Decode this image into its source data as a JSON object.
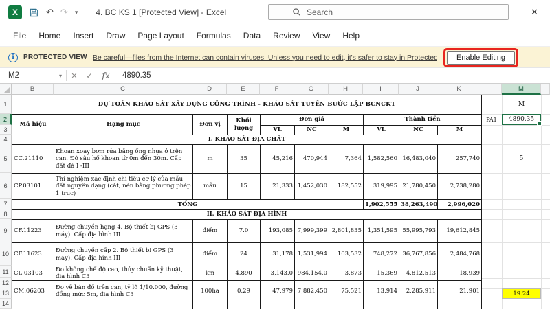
{
  "icons": {
    "excel": "X",
    "undo": "↶",
    "redo": "↷",
    "qat_caret": "▾",
    "close": "✕",
    "info": "i",
    "cancel": "✕",
    "enter": "✓",
    "namebox_caret": "▾"
  },
  "titlebar": {
    "title": "4. BC KS  1  [Protected View] -  Excel",
    "search_placeholder": "Search"
  },
  "ribbon": {
    "tabs": [
      "File",
      "Home",
      "Insert",
      "Draw",
      "Page Layout",
      "Formulas",
      "Data",
      "Review",
      "View",
      "Help"
    ]
  },
  "message_bar": {
    "label": "PROTECTED VIEW",
    "message": "Be careful—files from the Internet can contain viruses. Unless you need to edit, it's safer to stay in Protected View.",
    "button": "Enable Editing"
  },
  "formula_bar": {
    "name_box": "M2",
    "fx_label": "fx",
    "value": "4890.35"
  },
  "grid": {
    "col_headers": [
      "B",
      "C",
      "D",
      "E",
      "F",
      "G",
      "H",
      "I",
      "J",
      "K",
      "",
      "M",
      ""
    ],
    "row_headers": [
      "1",
      "2",
      "3",
      "4",
      "5",
      "6",
      "7",
      "8",
      "9",
      "10",
      "11",
      "12",
      "13",
      "14"
    ]
  },
  "sheet": {
    "title": "DỰ TOÁN KHẢO SÁT XÂY DỰNG CÔNG TRÌNH - KHẢO SÁT TUYẾN BƯỚC LẬP BCNCKT",
    "header": {
      "ma_hieu": "Mã hiệu",
      "hang_muc": "Hạng mục",
      "don_vi": "Đơn vị",
      "khoi_luong": "Khối lượng",
      "don_gia": "Đơn giá",
      "thanh_tien": "Thành tiền",
      "sub": [
        "VL",
        "NC",
        "M",
        "VL",
        "NC",
        "M"
      ]
    },
    "rows": [
      {
        "type": "section",
        "label": "I. KHẢO SÁT ĐỊA CHẤT"
      },
      {
        "type": "item",
        "code": "CC.21110",
        "desc": "Khoan xoay bơm rửa bằng ống nhựa ở trên cạn.  Độ sâu hố khoan từ 0m đến 30m. Cấp đất đá I -III",
        "unit": "m",
        "qty": "35",
        "cells": [
          "45,216",
          "470,944",
          "7,364",
          "1,582,560",
          "16,483,040",
          "257,740"
        ]
      },
      {
        "type": "item",
        "code": "CP.03101",
        "desc": "Thí nghiệm xác định chỉ tiêu cơ lý của mẫu đất nguyên dạng (cắt, nén bằng phương pháp 1 trục)",
        "unit": "mẫu",
        "qty": "15",
        "cells": [
          "21,333",
          "1,452,030",
          "182,552",
          "319,995",
          "21,780,450",
          "2,738,280"
        ]
      },
      {
        "type": "total",
        "label": "TỔNG",
        "cells": [
          "1,902,555",
          "38,263,490",
          "2,996,020"
        ]
      },
      {
        "type": "section",
        "label": "II. KHẢO SÁT ĐỊA HÌNH"
      },
      {
        "type": "item",
        "code": "CF.11223",
        "desc": "Đường chuyền hạng 4. Bộ thiết bị GPS (3 máy). Cấp địa hình III",
        "unit": "điểm",
        "qty": "7.0",
        "cells": [
          "193,085",
          "7,999,399",
          "2,801,835",
          "1,351,595",
          "55,995,793",
          "19,612,845"
        ]
      },
      {
        "type": "item",
        "code": "CF.11623",
        "desc": "Đường chuyền cấp 2. Bộ thiết bị GPS (3 máy). Cấp địa hình III",
        "unit": "điểm",
        "qty": "24",
        "cells": [
          "31,178",
          "1,531,994",
          "103,532",
          "748,272",
          "36,767,856",
          "2,484,768"
        ]
      },
      {
        "type": "item",
        "code": "CL.03103",
        "desc": "Đo khống chế độ cao, thủy chuẩn kỹ thuật, địa hình C3",
        "unit": "km",
        "qty": "4.890",
        "cells": [
          "3,143.0",
          "984,154.0",
          "3,873",
          "15,369",
          "4,812,513",
          "18,939"
        ]
      },
      {
        "type": "item",
        "code": "CM.06203",
        "desc": "Đo vẽ bản đồ trên cạn, tỷ lệ 1/10.000, đường đồng mức 5m, địa hình C3",
        "unit": "100ha",
        "qty": "0.29",
        "cells": [
          "47,979",
          "7,882,450",
          "75,521",
          "13,914",
          "2,285,911",
          "21,901"
        ]
      }
    ],
    "side": {
      "m1": "M",
      "l2": "PA1",
      "m2": "4890.35",
      "m5": "5",
      "m13": "19.24"
    }
  }
}
